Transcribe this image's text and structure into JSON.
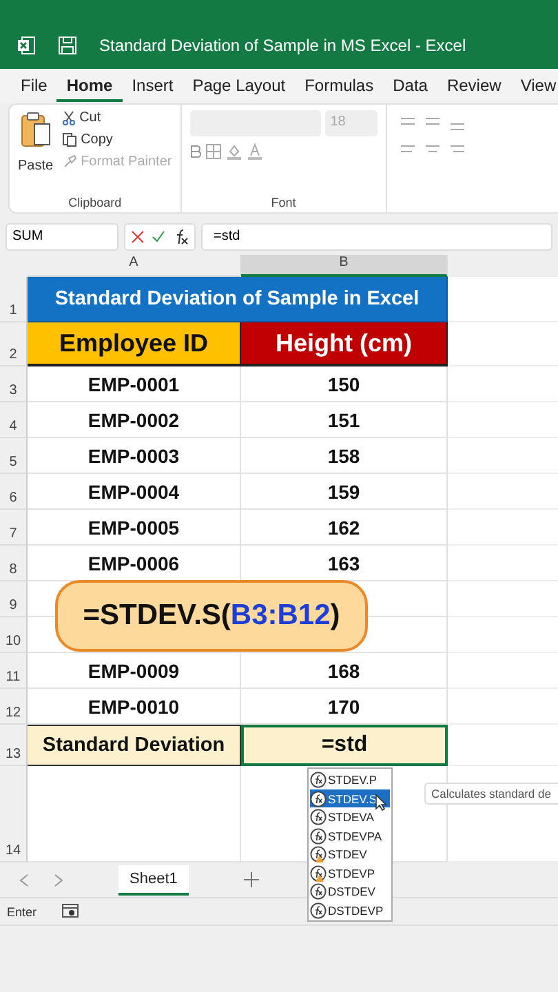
{
  "window": {
    "title": "Standard Deviation of Sample in MS Excel  -  Excel"
  },
  "ribbon_tabs": [
    {
      "label": "File",
      "selected": false
    },
    {
      "label": "Home",
      "selected": true
    },
    {
      "label": "Insert",
      "selected": false
    },
    {
      "label": "Page Layout",
      "selected": false
    },
    {
      "label": "Formulas",
      "selected": false
    },
    {
      "label": "Data",
      "selected": false
    },
    {
      "label": "Review",
      "selected": false
    },
    {
      "label": "View",
      "selected": false
    }
  ],
  "clipboard": {
    "paste": "Paste",
    "cut": "Cut",
    "copy": "Copy",
    "format_painter": {
      "label": "Format Painter",
      "disabled": true
    },
    "group_label": "Clipboard"
  },
  "font": {
    "size": "18",
    "group_label": "Font"
  },
  "formula_bar": {
    "name_box": "SUM",
    "value": "=std"
  },
  "columns": [
    {
      "label": "A",
      "selected": false
    },
    {
      "label": "B",
      "selected": true
    }
  ],
  "rows": [
    {
      "number": "1",
      "kind": "title",
      "a": "Standard Deviation of Sample in Excel"
    },
    {
      "number": "2",
      "kind": "header",
      "a": "Employee ID",
      "b": "Height (cm)"
    },
    {
      "number": "3",
      "kind": "data",
      "a": "EMP-0001",
      "b": "150"
    },
    {
      "number": "4",
      "kind": "data",
      "a": "EMP-0002",
      "b": "151"
    },
    {
      "number": "5",
      "kind": "data",
      "a": "EMP-0003",
      "b": "158"
    },
    {
      "number": "6",
      "kind": "data",
      "a": "EMP-0004",
      "b": "159"
    },
    {
      "number": "7",
      "kind": "data",
      "a": "EMP-0005",
      "b": "162"
    },
    {
      "number": "8",
      "kind": "data",
      "a": "EMP-0006",
      "b": "163"
    },
    {
      "number": "9",
      "kind": "data"
    },
    {
      "number": "10",
      "kind": "data"
    },
    {
      "number": "11",
      "kind": "data",
      "a": "EMP-0009",
      "b": "168"
    },
    {
      "number": "12",
      "kind": "data",
      "a": "EMP-0010",
      "b": "170"
    },
    {
      "number": "13",
      "kind": "total",
      "a": "Standard Deviation",
      "b": "=std"
    },
    {
      "number": "14",
      "kind": "blank"
    }
  ],
  "callout": [
    {
      "text": "=STDEV.S(",
      "kind": "plain"
    },
    {
      "text": "B3:B12",
      "kind": "ref"
    },
    {
      "text": ")",
      "kind": "plain"
    }
  ],
  "autocomplete": [
    {
      "label": "STDEV.P",
      "kind": "function",
      "selected": false
    },
    {
      "label": "STDEV.S",
      "kind": "function",
      "selected": true
    },
    {
      "label": "STDEVA",
      "kind": "function",
      "selected": false
    },
    {
      "label": "STDEVPA",
      "kind": "function",
      "selected": false
    },
    {
      "label": "STDEV",
      "kind": "legacy",
      "selected": false
    },
    {
      "label": "STDEVP",
      "kind": "legacy",
      "selected": false
    },
    {
      "label": "DSTDEV",
      "kind": "function",
      "selected": false
    },
    {
      "label": "DSTDEVP",
      "kind": "function",
      "selected": false
    }
  ],
  "tooltip": "Calculates standard de",
  "sheet_tabs": [
    {
      "label": "Sheet1",
      "selected": true
    }
  ],
  "status_bar": {
    "mode": "Enter"
  }
}
